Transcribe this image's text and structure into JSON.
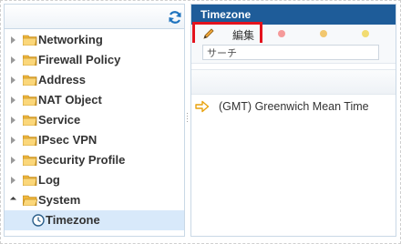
{
  "tree": {
    "items": [
      {
        "label": "Networking",
        "state": "collapsed"
      },
      {
        "label": "Firewall Policy",
        "state": "collapsed"
      },
      {
        "label": "Address",
        "state": "collapsed"
      },
      {
        "label": "NAT Object",
        "state": "collapsed"
      },
      {
        "label": "Service",
        "state": "collapsed"
      },
      {
        "label": "IPsec VPN",
        "state": "collapsed"
      },
      {
        "label": "Security Profile",
        "state": "collapsed"
      },
      {
        "label": "Log",
        "state": "collapsed"
      },
      {
        "label": "System",
        "state": "expanded"
      }
    ],
    "selected_child": {
      "label": "Timezone"
    }
  },
  "panel": {
    "title": "Timezone",
    "toolbar": {
      "edit_label": "編集"
    },
    "search": {
      "value": "サーチ",
      "placeholder": ""
    },
    "rows": [
      {
        "text": "(GMT) Greenwich Mean Time"
      }
    ]
  },
  "colors": {
    "title_bar": "#1e5c99",
    "selection": "#d8e9fa",
    "highlight": "#e3131e",
    "folder": "#f0b73c"
  }
}
